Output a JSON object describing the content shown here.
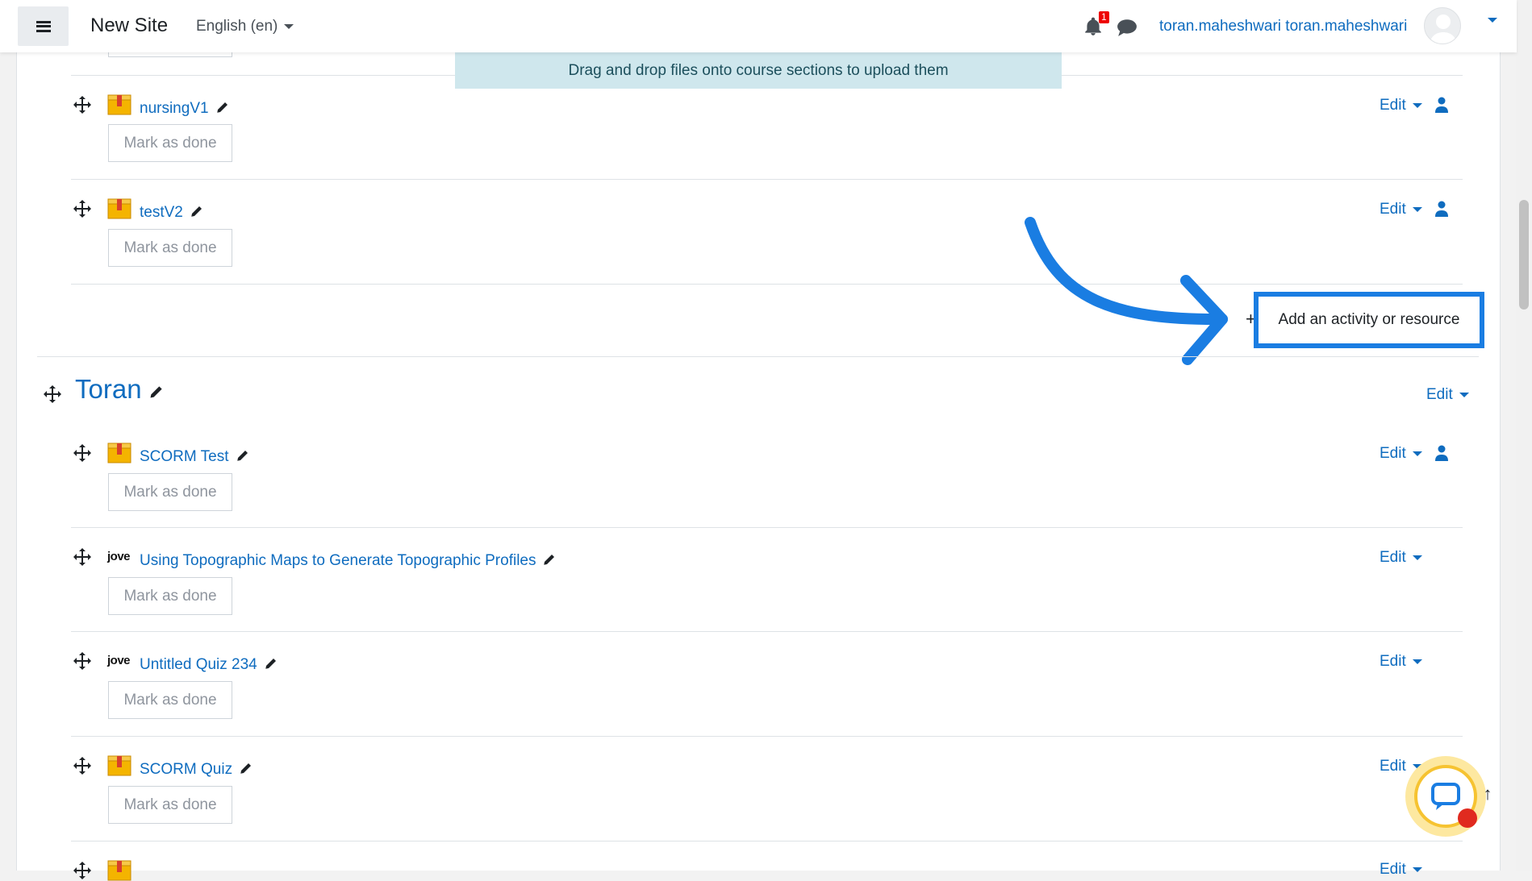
{
  "header": {
    "site_name": "New Site",
    "language": "English (en)",
    "notification_count": "1",
    "user_name": "toran.maheshwari toran.maheshwari"
  },
  "banner": "Drag and drop files onto course sections to upload them",
  "mark_done_label": "Mark as done",
  "edit_label": "Edit",
  "add_activity_label": "Add an activity or resource",
  "section": {
    "title": "Toran"
  },
  "activities_prev": [
    {
      "name": "nursingV1",
      "icon": "scorm-package-icon"
    },
    {
      "name": "testV2",
      "icon": "scorm-package-icon"
    }
  ],
  "activities": [
    {
      "name": "SCORM Test",
      "icon": "scorm-package-icon"
    },
    {
      "name": "Using Topographic Maps to Generate Topographic Profiles",
      "icon": "jove-logo-icon"
    },
    {
      "name": "Untitled Quiz 234",
      "icon": "jove-logo-icon"
    },
    {
      "name": "SCORM Quiz",
      "icon": "scorm-package-icon"
    }
  ],
  "jove_text": "jove",
  "colors": {
    "link": "#0f6cbf",
    "highlight": "#1a7de2",
    "banner_bg": "#cfe7ed"
  }
}
